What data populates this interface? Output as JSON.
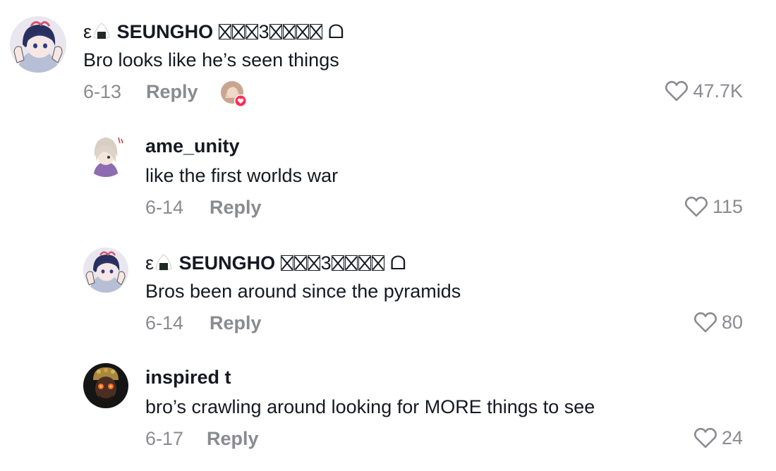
{
  "comments": [
    {
      "username_prefix": "ε",
      "username": "SEUNGHO",
      "username_suffix_glyph": "3",
      "username_end": "ᗝ",
      "text": "Bro looks like he’s seen things",
      "date": "6-13",
      "reply_label": "Reply",
      "likes": "47.7K",
      "creator_liked": true,
      "level": 0
    },
    {
      "username": "ame_unity",
      "text": "like the first worlds war",
      "date": "6-14",
      "reply_label": "Reply",
      "likes": "115",
      "level": 1
    },
    {
      "username_prefix": "ε",
      "username": "SEUNGHO",
      "username_suffix_glyph": "3",
      "username_end": "ᗝ",
      "text": "Bros been around since the pyramids",
      "date": "6-14",
      "reply_label": "Reply",
      "likes": "80",
      "level": 1
    },
    {
      "username": "inspired t",
      "text": "bro’s crawling around looking for MORE things to see",
      "date": "6-17",
      "reply_label": "Reply",
      "likes": "24",
      "level": 1
    }
  ],
  "icons": {
    "like": "heart-outline-icon",
    "creator_like": "heart-filled-badge-icon"
  },
  "colors": {
    "text_primary": "#161823",
    "text_secondary": "#8a8b91",
    "heart_badge": "#fe2c55"
  }
}
